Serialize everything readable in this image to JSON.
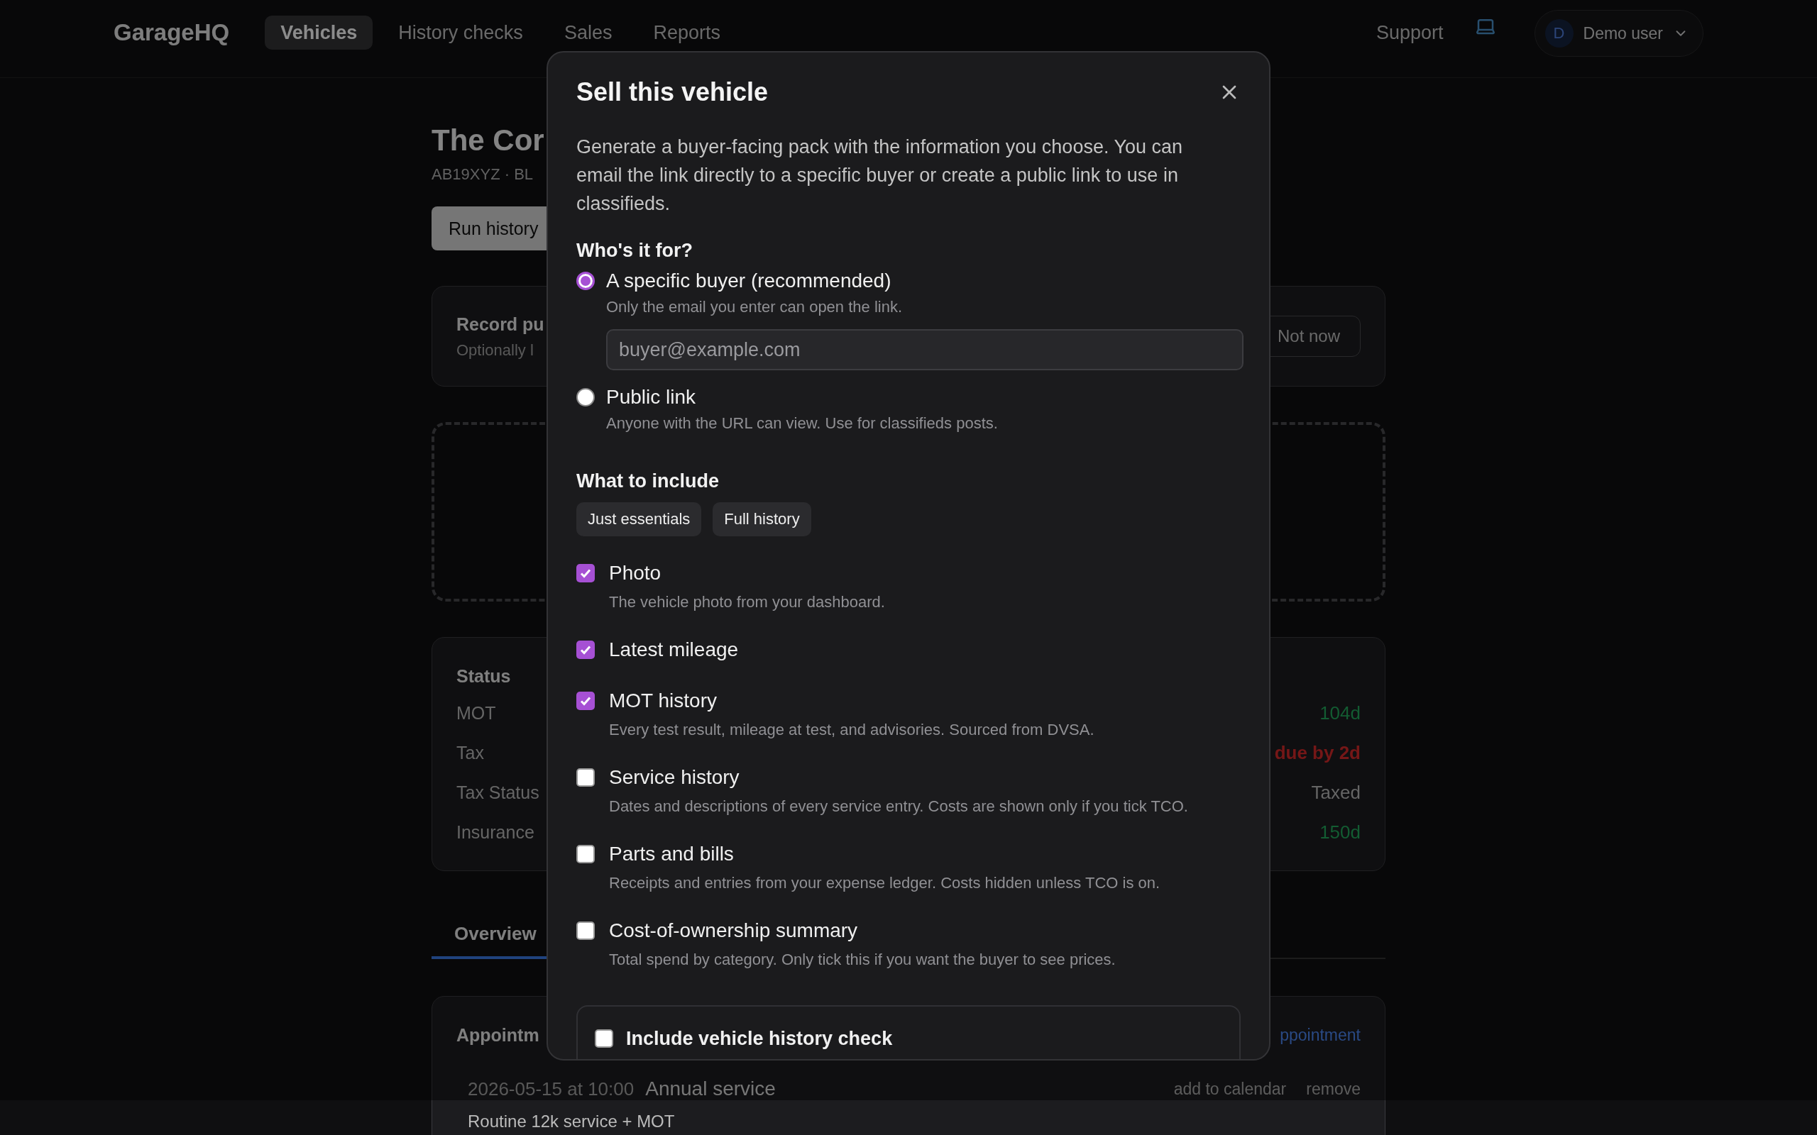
{
  "nav": {
    "logo": "GarageHQ",
    "links": [
      {
        "label": "Vehicles",
        "selected": true
      },
      {
        "label": "History checks",
        "selected": false
      },
      {
        "label": "Sales",
        "selected": false
      },
      {
        "label": "Reports",
        "selected": false
      }
    ],
    "support": "Support",
    "user": {
      "initial": "D",
      "name": "Demo user"
    }
  },
  "page": {
    "title": "The Cor",
    "subtitle": "AB19XYZ · BL",
    "primary_button": "Run history",
    "purchase_card": {
      "title": "Record pu",
      "subtitle": "Optionally l",
      "button": "Not now"
    },
    "status": {
      "title": "Status",
      "rows": [
        {
          "label": "MOT",
          "value": "104d",
          "color": "#135c32",
          "highlight": false
        },
        {
          "label": "Tax",
          "value": "due by 2d",
          "color": "#751717",
          "highlight": true
        },
        {
          "label": "Tax Status",
          "value": "Taxed",
          "color": "#656565",
          "highlight": false
        },
        {
          "label": "Insurance",
          "value": "150d",
          "color": "#135c32",
          "highlight": false
        }
      ]
    },
    "tabs": [
      {
        "label": "Overview",
        "selected": true
      }
    ],
    "appointments": {
      "title": "Appointm",
      "action": "ppointment",
      "item": {
        "datetime": "2026-05-15 at 10:00",
        "title": "Annual service",
        "actions": [
          "add to calendar",
          "remove"
        ],
        "note": "Routine 12k service + MOT"
      }
    }
  },
  "modal": {
    "title": "Sell this vehicle",
    "description": "Generate a buyer-facing pack with the information you choose. You can email the link directly to a specific buyer or create a public link to use in classifieds.",
    "audience": {
      "heading": "Who's it for?",
      "options": [
        {
          "label": "A specific buyer (recommended)",
          "hint": "Only the email you enter can open the link.",
          "selected": true,
          "field": {
            "placeholder": "buyer@example.com"
          }
        },
        {
          "label": "Public link",
          "hint": "Anyone with the URL can view. Use for classifieds posts.",
          "selected": false
        }
      ]
    },
    "include": {
      "heading": "What to include",
      "presets": [
        "Just essentials",
        "Full history"
      ],
      "items": [
        {
          "label": "Photo",
          "hint": "The vehicle photo from your dashboard.",
          "checked": true
        },
        {
          "label": "Latest mileage",
          "checked": true
        },
        {
          "label": "MOT history",
          "hint": "Every test result, mileage at test, and advisories. Sourced from DVSA.",
          "checked": true
        },
        {
          "label": "Service history",
          "hint": "Dates and descriptions of every service entry. Costs are shown only if you tick TCO.",
          "checked": false
        },
        {
          "label": "Parts and bills",
          "hint": "Receipts and entries from your expense ledger. Costs hidden unless TCO is on.",
          "checked": false
        },
        {
          "label": "Cost-of-ownership summary",
          "hint": "Total spend by category. Only tick this if you want the buyer to see prices.",
          "checked": false
        }
      ],
      "history_check": {
        "label": "Include vehicle history check",
        "checked": false
      }
    }
  }
}
